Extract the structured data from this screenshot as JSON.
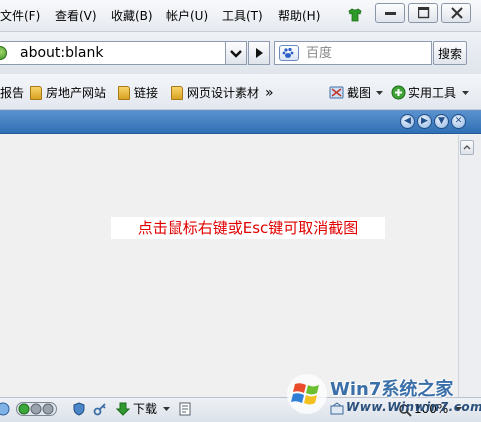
{
  "menu": {
    "items": [
      "文件(F)",
      "查看(V)",
      "收藏(B)",
      "帐户(U)",
      "工具(T)",
      "帮助(H)"
    ]
  },
  "address": {
    "url": "about:blank"
  },
  "search": {
    "placeholder": "百度",
    "button_label": "搜索"
  },
  "favorites": {
    "partial_item": "报告",
    "items": [
      "房地产网站",
      "链接",
      "网页设计素材"
    ],
    "overflow": "»",
    "screenshot_tool": "截图",
    "utilities": "实用工具"
  },
  "content": {
    "hint": "点击鼠标右键或Esc键可取消截图"
  },
  "status": {
    "download_label": "下载",
    "zoom": "100%"
  },
  "watermark": {
    "brand": "Win7系统之家",
    "url": "Www.Winwin7.com"
  },
  "colors": {
    "hint_text": "#e00000",
    "tab_strip": "#3a7cc2"
  }
}
